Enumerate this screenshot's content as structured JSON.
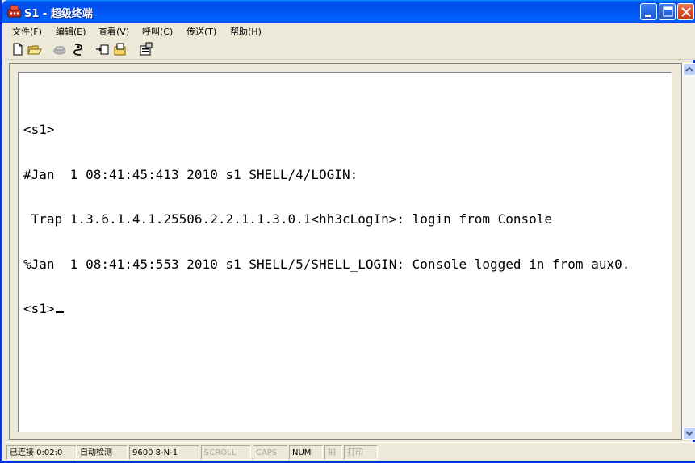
{
  "window": {
    "title": "S1 - 超级终端",
    "icon": "hyperterminal-icon"
  },
  "menu": {
    "items": [
      {
        "label": "文件(F)"
      },
      {
        "label": "编辑(E)"
      },
      {
        "label": "查看(V)"
      },
      {
        "label": "呼叫(C)"
      },
      {
        "label": "传送(T)"
      },
      {
        "label": "帮助(H)"
      }
    ]
  },
  "toolbar": {
    "icons": [
      "new-document-icon",
      "open-folder-icon",
      "call-icon",
      "disconnect-icon",
      "send-file-icon",
      "receive-file-icon",
      "properties-icon"
    ]
  },
  "terminal": {
    "lines": [
      "<s1>",
      "#Jan  1 08:41:45:413 2010 s1 SHELL/4/LOGIN:",
      " Trap 1.3.6.1.4.1.25506.2.2.1.1.3.0.1<hh3cLogIn>: login from Console",
      "%Jan  1 08:41:45:553 2010 s1 SHELL/5/SHELL_LOGIN: Console logged in from aux0.",
      "<s1>"
    ]
  },
  "status": {
    "connection": "已连接 0:02:0",
    "detect": "自动检测",
    "port_settings": "9600 8-N-1",
    "scroll": "SCROLL",
    "caps": "CAPS",
    "num": "NUM",
    "capture": "捕",
    "print": "打印"
  },
  "colors": {
    "titlebar": "#0053EE",
    "terminal_bg": "#FFFFFF",
    "window_bg": "#ECE9D8"
  }
}
